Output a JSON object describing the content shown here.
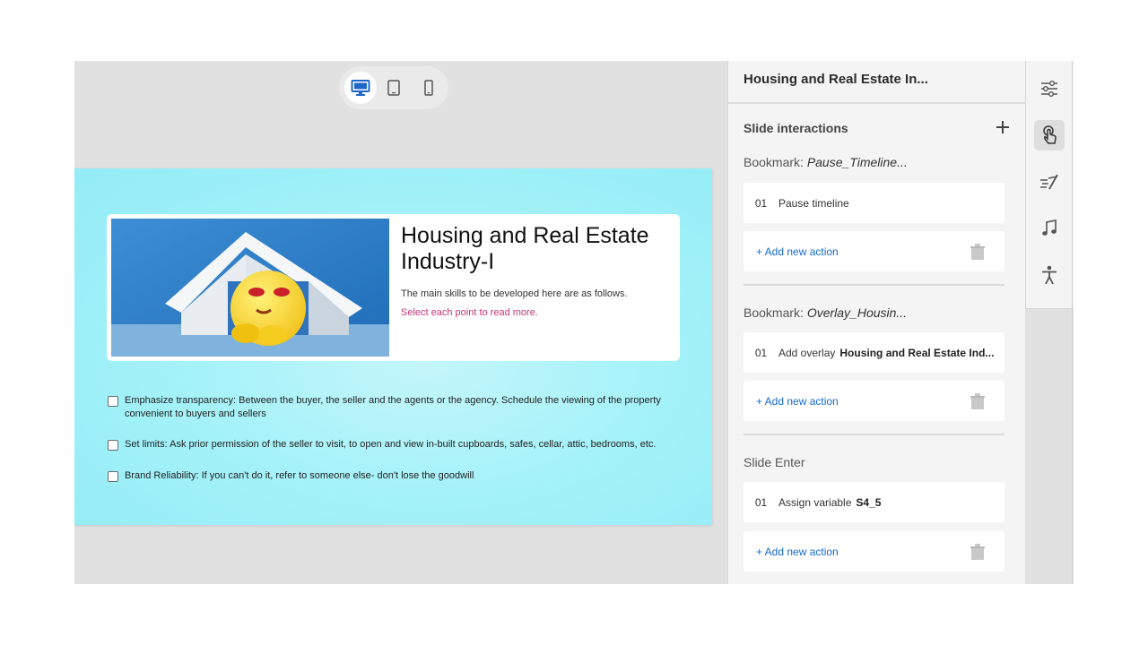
{
  "device_switcher": {
    "selected": "desktop"
  },
  "slide": {
    "title": "Housing and Real Estate Industry-I",
    "description": "The main skills to be developed here are as follows.",
    "hint": "Select each point to read more.",
    "checklist": [
      "Emphasize transparency: Between the buyer, the seller and the agents or the agency. Schedule the viewing of the property convenient to buyers and sellers",
      "Set limits: Ask prior permission of the seller to visit, to open and view in-built cupboards, safes, cellar, attic, bedrooms, etc.",
      "Brand Reliability: If you can't do it, refer to someone else- don't lose the goodwill"
    ]
  },
  "panel": {
    "title": "Housing and Real Estate In...",
    "section_title": "Slide interactions",
    "groups": [
      {
        "prefix": "Bookmark:",
        "name": "Pause_Timeline...",
        "action_num": "01",
        "action_label": "Pause timeline",
        "action_extra": "",
        "add_label": "+ Add new action"
      },
      {
        "prefix": "Bookmark:",
        "name": "Overlay_Housin...",
        "action_num": "01",
        "action_label": "Add overlay",
        "action_extra": "Housing and Real Estate Ind...",
        "add_label": "+ Add new action"
      },
      {
        "prefix": "Slide Enter",
        "name": "",
        "action_num": "01",
        "action_label": "Assign variable",
        "action_extra": "S4_5",
        "add_label": "+ Add new action"
      }
    ]
  },
  "rail": {
    "icons": [
      "properties-sliders-icon",
      "interactions-touch-icon",
      "animation-icon",
      "audio-icon",
      "accessibility-icon"
    ],
    "active": "interactions-touch-icon"
  },
  "colors": {
    "accent": "#1469cf",
    "hint": "#c2357d",
    "slide_bg": "#a6f2f9"
  }
}
